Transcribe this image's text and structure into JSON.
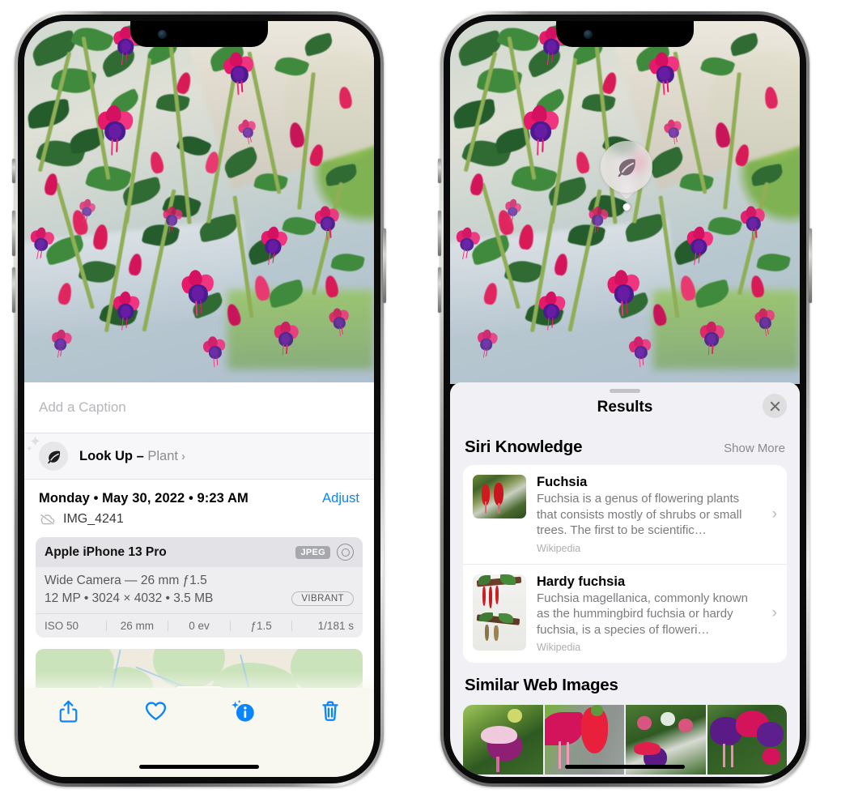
{
  "left_phone": {
    "photo": {
      "alt_name": "fuchsia-flowers-photo"
    },
    "caption": {
      "placeholder": "Add a Caption",
      "value": ""
    },
    "look_up": {
      "icon": "leaf-icon",
      "label": "Look Up",
      "dash": " – ",
      "subject": "Plant",
      "chevron": "›"
    },
    "metadata": {
      "date_line": "Monday • May 30, 2022 • 9:23 AM",
      "adjust_label": "Adjust",
      "cloud_icon": "icloud-slash-icon",
      "filename": "IMG_4241"
    },
    "camera_card": {
      "model": "Apple iPhone 13 Pro",
      "format_badge": "JPEG",
      "lens_icon": "aperture-icon",
      "lens_line": "Wide Camera — 26 mm ƒ1.5",
      "spec_line": "12 MP • 3024 × 4032 • 3.5 MB",
      "style_badge": "VIBRANT",
      "exif": [
        "ISO 50",
        "26 mm",
        "0 ev",
        "ƒ1.5",
        "1/181 s"
      ]
    },
    "map": {
      "name": "location-map-thumbnail",
      "pin": "photo-pin"
    },
    "toolbar": [
      {
        "name": "share-button",
        "icon": "share-icon"
      },
      {
        "name": "favorite-button",
        "icon": "heart-icon"
      },
      {
        "name": "info-button",
        "icon": "info-sparkle-icon",
        "active": true
      },
      {
        "name": "delete-button",
        "icon": "trash-icon"
      }
    ]
  },
  "right_phone": {
    "visual_look_up_badge": {
      "icon": "leaf-icon",
      "name": "visual-look-up-badge"
    },
    "sheet": {
      "grabber": "drag-handle",
      "title": "Results",
      "close_icon": "close-icon",
      "siri_knowledge": {
        "heading": "Siri Knowledge",
        "show_more": "Show More",
        "items": [
          {
            "title": "Fuchsia",
            "description": "Fuchsia is a genus of flowering plants that consists mostly of shrubs or small trees. The first to be scientific…",
            "source": "Wikipedia",
            "chevron": "›",
            "thumb": "fuchsia-thumb"
          },
          {
            "title": "Hardy fuchsia",
            "description": "Fuchsia magellanica, commonly known as the hummingbird fuchsia or hardy fuchsia, is a species of floweri…",
            "source": "Wikipedia",
            "chevron": "›",
            "thumb": "hardy-fuchsia-thumb"
          }
        ]
      },
      "similar_web_images": {
        "heading": "Similar Web Images",
        "items": [
          {
            "name": "web-image-1"
          },
          {
            "name": "web-image-2"
          },
          {
            "name": "web-image-3"
          },
          {
            "name": "web-image-4"
          }
        ]
      }
    }
  },
  "colors": {
    "accent_blue": "#0a84ff",
    "sheet_bg": "#f1f1f5",
    "card_bg": "#ffffff",
    "toolbar_bg": "#f8f8f1",
    "secondary_text": "#8a8a8f"
  }
}
